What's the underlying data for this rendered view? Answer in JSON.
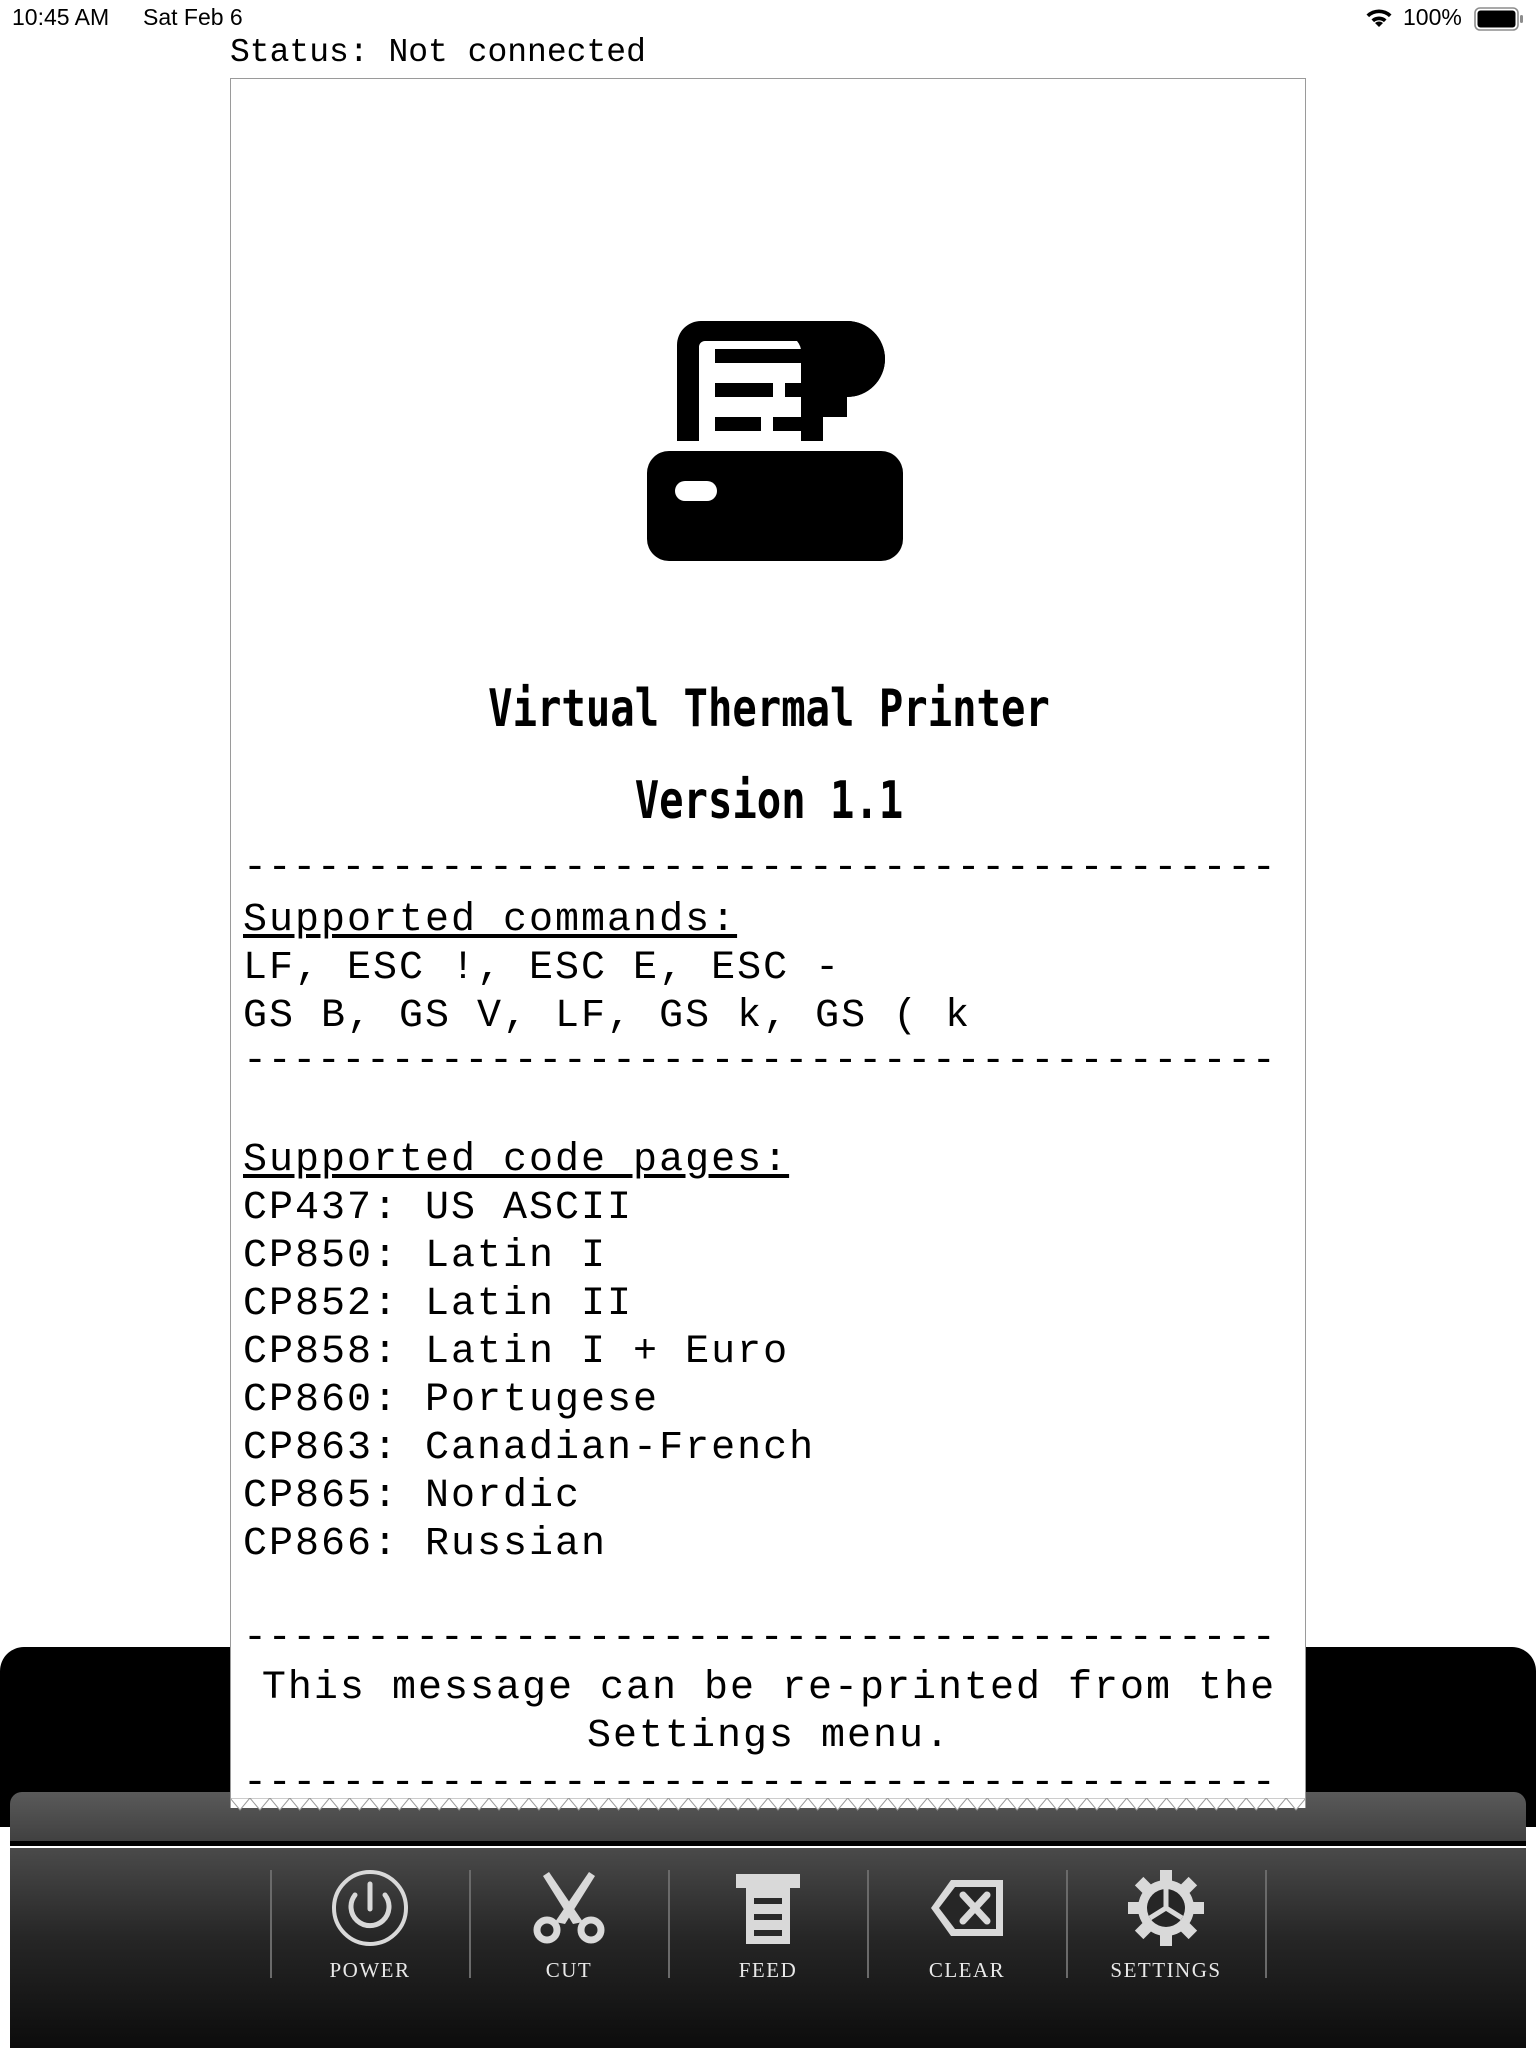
{
  "status_bar": {
    "time": "10:45 AM",
    "date": "Sat Feb 6",
    "battery": "100%",
    "wifi_icon": "wifi-icon",
    "battery_icon": "battery-full-icon"
  },
  "connection": {
    "label": "Status:",
    "value": "Not connected"
  },
  "receipt": {
    "logo_icon": "receipt-printer-icon",
    "title": "Virtual Thermal Printer",
    "version": "Version 1.1",
    "divider": "------------------------------------------",
    "commands_heading": "Supported commands:",
    "commands": [
      "LF, ESC !, ESC E, ESC -",
      "GS B, GS V, LF, GS k, GS ( k"
    ],
    "code_pages_heading": "Supported code pages:",
    "code_pages": [
      "CP437: US ASCII",
      "CP850: Latin I",
      "CP852: Latin II",
      "CP858: Latin I + Euro",
      "CP860: Portugese",
      "CP863: Canadian-French",
      "CP865: Nordic",
      "CP866: Russian"
    ],
    "footer_lines": [
      "This message can be re-printed from the",
      "Settings menu."
    ]
  },
  "toolbar": {
    "power": {
      "label": "POWER",
      "icon": "power-icon"
    },
    "cut": {
      "label": "CUT",
      "icon": "scissors-icon"
    },
    "feed": {
      "label": "FEED",
      "icon": "paper-feed-icon"
    },
    "clear": {
      "label": "CLEAR",
      "icon": "clear-icon"
    },
    "settings": {
      "label": "SETTINGS",
      "icon": "gear-icon"
    }
  },
  "colors": {
    "printer_body": "#000000",
    "toolbar_top": "#4a4a4a",
    "toolbar_bottom": "#0c0c0c",
    "icon_fill": "#d9d9d9",
    "paper": "#ffffff"
  }
}
